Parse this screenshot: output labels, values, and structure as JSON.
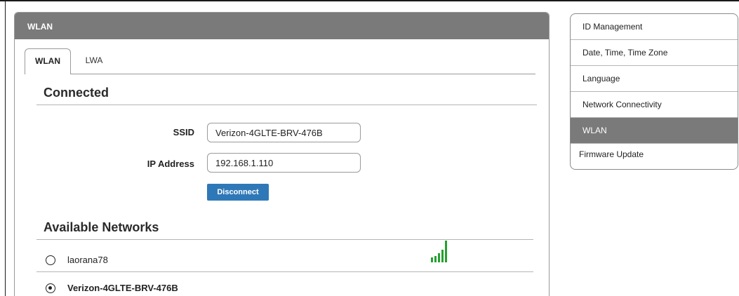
{
  "panel": {
    "title": "WLAN"
  },
  "tabs": [
    {
      "label": "WLAN",
      "active": true
    },
    {
      "label": "LWA",
      "active": false
    }
  ],
  "connected": {
    "heading": "Connected",
    "ssid_label": "SSID",
    "ssid_value": "Verizon-4GLTE-BRV-476B",
    "ip_label": "IP Address",
    "ip_value": "192.168.1.110",
    "disconnect_label": "Disconnect"
  },
  "available": {
    "heading": "Available Networks",
    "networks": [
      {
        "name": "laorana78",
        "selected": false,
        "signal_bars": 5
      },
      {
        "name": "Verizon-4GLTE-BRV-476B",
        "selected": true
      }
    ]
  },
  "sidebar": {
    "items": [
      {
        "label": "ID Management",
        "active": false
      },
      {
        "label": "Date, Time, Time Zone",
        "active": false
      },
      {
        "label": "Language",
        "active": false
      },
      {
        "label": "Network Connectivity",
        "active": false
      },
      {
        "label": "WLAN",
        "active": true
      },
      {
        "label": "Firmware Update",
        "active": false
      }
    ]
  },
  "colors": {
    "header_gray": "#7a7a7a",
    "button_blue": "#2f78b8",
    "signal_green": "#24a12f"
  }
}
